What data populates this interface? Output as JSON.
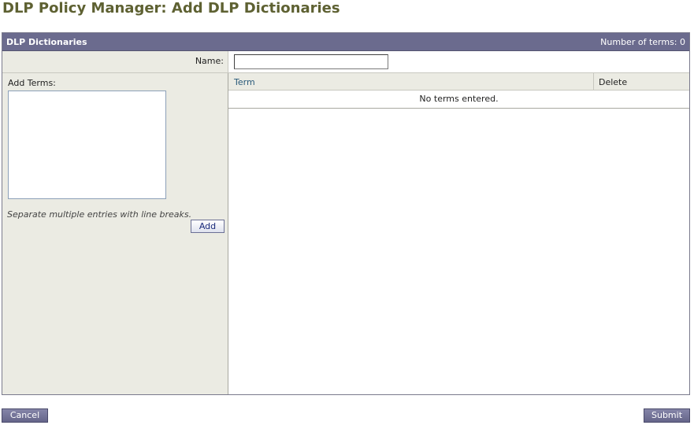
{
  "page": {
    "title": "DLP Policy Manager: Add DLP Dictionaries"
  },
  "panel": {
    "title": "DLP Dictionaries",
    "count_text": "Number of terms:  0"
  },
  "name_field": {
    "label": "Name:",
    "value": ""
  },
  "add_terms": {
    "label": "Add Terms:",
    "value": "",
    "hint": "Separate multiple entries with line breaks.",
    "add_button_label": "Add"
  },
  "terms_table": {
    "columns": [
      "Term",
      "Delete"
    ],
    "empty_text": "No terms entered."
  },
  "footer": {
    "cancel_label": "Cancel",
    "submit_label": "Submit"
  },
  "colors": {
    "title": "#5e6132",
    "header_bg": "#6b6b8e",
    "label_bg": "#ebebe3"
  }
}
